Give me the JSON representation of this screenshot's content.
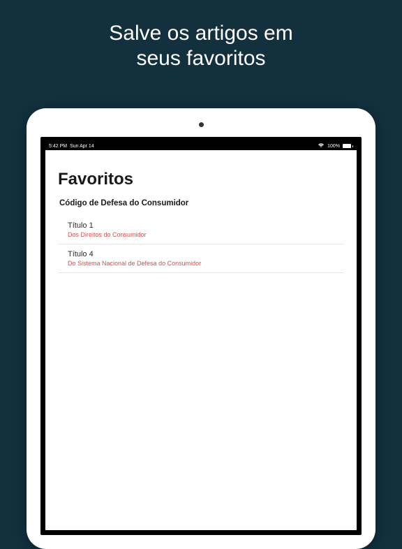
{
  "promo": {
    "line1": "Salve os artigos em",
    "line2": "seus favoritos"
  },
  "statusBar": {
    "time": "5:42 PM",
    "date": "Sun Apr 14",
    "battery": "100%"
  },
  "page": {
    "title": "Favoritos",
    "sectionHeader": "Código de Defesa do Consumidor"
  },
  "items": [
    {
      "title": "Título 1",
      "subtitle": "Dos Direitos do Consumidor"
    },
    {
      "title": "Título 4",
      "subtitle": "Do Sistema Nacional de Defesa do Consumidor"
    }
  ]
}
